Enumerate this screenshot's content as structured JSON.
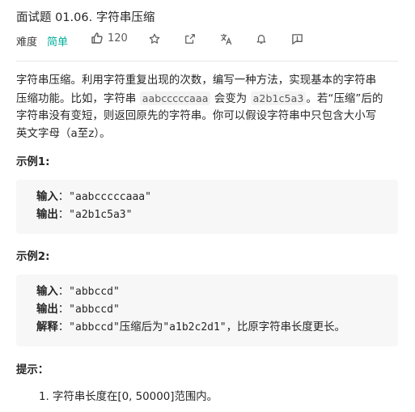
{
  "problem": {
    "title": "面试题 01.06. 字符串压缩",
    "difficulty_label": "难度",
    "difficulty": "简单",
    "like_count": "120"
  },
  "toolbar_icons": [
    "thumbs-up-icon",
    "star-icon",
    "share-icon",
    "translate-icon",
    "bell-icon",
    "feedback-icon"
  ],
  "colors": {
    "difficulty_easy": "#00af9b",
    "example_bg": "#f7f7f8",
    "divider": "#e6e6e6"
  },
  "description": {
    "line1": "字符串压缩。利用字符重复出现的次数，编写一种方法，实现基本的字符串",
    "line2_a": "压缩功能。比如，字符串",
    "code1": "aabcccccaaa",
    "line2_b": "会变为",
    "code2": "a2b1c5a3",
    "line2_c": "。若“压缩”后的",
    "line3": "字符串没有变短，则返回原先的字符串。你可以假设字符串中只包含大小写",
    "line4": "英文字母（a至z）。"
  },
  "examples": [
    {
      "heading": "示例1:",
      "input_label": "输入",
      "input_value": "\"aabcccccaaa\"",
      "output_label": "输出",
      "output_value": "\"a2b1c5a3\""
    },
    {
      "heading": "示例2:",
      "input_label": "输入",
      "input_value": "\"abbccd\"",
      "output_label": "输出",
      "output_value": "\"abbccd\"",
      "explain_label": "解释",
      "explain_code1": "\"abbccd\"",
      "explain_text1": "压缩后为",
      "explain_code2": "\"a1b2c2d1\"",
      "explain_text2": "，比原字符串长度更长。"
    }
  ],
  "hints": {
    "heading": "提示：",
    "items": [
      "1. 字符串长度在[0, 50000]范围内。"
    ]
  }
}
